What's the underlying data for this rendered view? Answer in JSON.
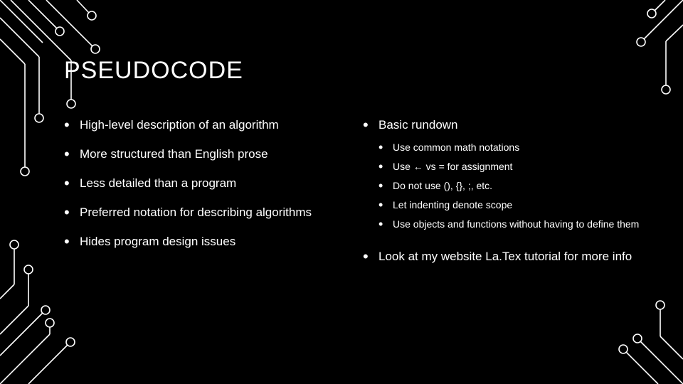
{
  "title": "PSEUDOCODE",
  "left": {
    "items": [
      "High-level description of an algorithm",
      "More structured than English prose",
      "Less detailed than a program",
      "Preferred notation for describing algorithms",
      "Hides program design issues"
    ]
  },
  "right": {
    "item0": {
      "label": "Basic rundown",
      "sub": [
        "Use common math notations",
        "Use ← vs = for assignment",
        "Do not use (), {}, ;, etc.",
        "Let indenting denote scope",
        "Use objects and functions without having to define them"
      ]
    },
    "item1": "Look at my website La.Tex tutorial for more info"
  }
}
